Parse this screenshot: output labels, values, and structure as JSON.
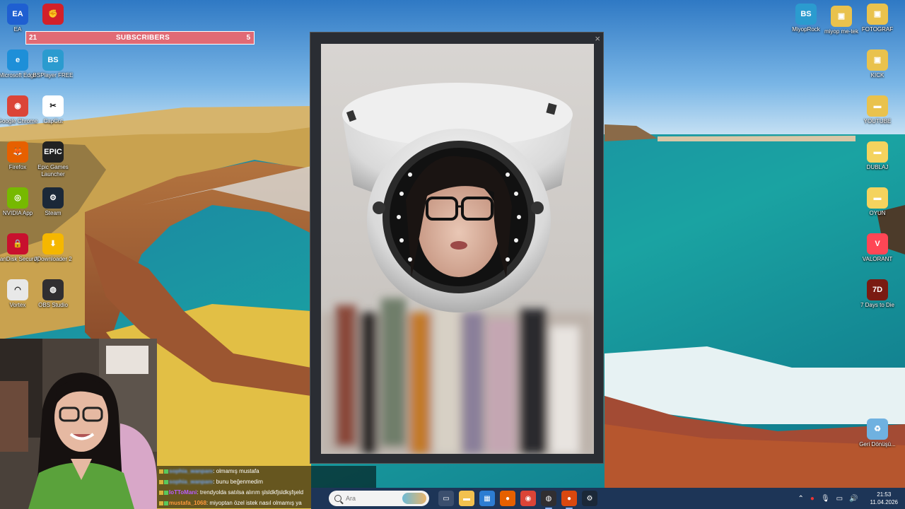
{
  "desktop_icons_left": [
    {
      "label": "EA",
      "icon": "ea-icon",
      "color": "#1f5fd1",
      "glyph": "EA"
    },
    {
      "label": "",
      "icon": "riot-client-icon",
      "color": "#d3202a",
      "glyph": "✊"
    },
    {
      "label": "Microsoft Edge",
      "icon": "edge-icon",
      "color": "#1e8fd8",
      "glyph": "e"
    },
    {
      "label": "BSPlayer FREE",
      "icon": "bsplayer-icon",
      "color": "#2b9bcf",
      "glyph": "BS"
    },
    {
      "label": "Google Chrome",
      "icon": "chrome-icon",
      "color": "#db4437",
      "glyph": "◉"
    },
    {
      "label": "CapCut",
      "icon": "capcut-icon",
      "color": "#ffffff",
      "glyph": "✂"
    },
    {
      "label": "Firefox",
      "icon": "firefox-icon",
      "color": "#e66000",
      "glyph": "🦊"
    },
    {
      "label": "Epic Games Launcher",
      "icon": "epic-games-icon",
      "color": "#222222",
      "glyph": "EPIC"
    },
    {
      "label": "NVIDIA App",
      "icon": "nvidia-icon",
      "color": "#76b900",
      "glyph": "◎"
    },
    {
      "label": "Steam",
      "icon": "steam-icon",
      "color": "#1b2838",
      "glyph": "⚙"
    },
    {
      "label": "SanDisk Security",
      "icon": "sandisk-lock-icon",
      "color": "#c8102e",
      "glyph": "🔒"
    },
    {
      "label": "JDownloader 2",
      "icon": "jdownloader-icon",
      "color": "#f5b700",
      "glyph": "⬇"
    },
    {
      "label": "Vortex",
      "icon": "vortex-icon",
      "color": "#e8e8e8",
      "glyph": "◠"
    },
    {
      "label": "OBS Studio",
      "icon": "obs-icon",
      "color": "#302e31",
      "glyph": "◍"
    }
  ],
  "desktop_icons_right": [
    {
      "label": "MiyopRock",
      "icon": "bsplayer-icon",
      "color": "#2b9bcf",
      "glyph": "BS"
    },
    {
      "label": "miyop me-tek",
      "icon": "folder-photo-icon",
      "color": "#e9c24d",
      "glyph": "▣"
    },
    {
      "label": "FOTOGRAF",
      "icon": "folder-photo-icon",
      "color": "#e9c24d",
      "glyph": "▣"
    },
    {
      "label": "KICK",
      "icon": "folder-photo-icon",
      "color": "#e9c24d",
      "glyph": "▣"
    },
    {
      "label": "YOUTUBE",
      "icon": "folder-icon",
      "color": "#e9c24d",
      "glyph": "▬"
    },
    {
      "label": "DUBLAJ",
      "icon": "folder-icon",
      "color": "#f4d35e",
      "glyph": "▬"
    },
    {
      "label": "OYUN",
      "icon": "folder-icon",
      "color": "#f4d35e",
      "glyph": "▬"
    },
    {
      "label": "VALORANT",
      "icon": "valorant-icon",
      "color": "#ff4655",
      "glyph": "V"
    },
    {
      "label": "7 Days to Die",
      "icon": "7days-icon",
      "color": "#7a1b12",
      "glyph": "7D"
    },
    {
      "label": "Geri Dönüşü...",
      "icon": "recycle-bin-icon",
      "color": "#6fb1e0",
      "glyph": "♻"
    }
  ],
  "subscribers_bar": {
    "left": "21",
    "title": "SUBSCRIBERS",
    "right": "5"
  },
  "photo_window": {
    "close_label": "×"
  },
  "chat": [
    {
      "user": "sophia_wanpanı",
      "message": ": olmamış mustafa",
      "user_color": "#6fa8ff",
      "blurred": true
    },
    {
      "user": "sophia_wanpanı",
      "message": ": bunu beğenmedim",
      "user_color": "#6fa8ff",
      "blurred": true
    },
    {
      "user": "IoTToMani",
      "message": ": trendyolda satılsa alırım şlsldkfjsldkşfşeld",
      "user_color": "#b85cff",
      "blurred": false
    },
    {
      "user": "mustafa_1068",
      "message": ": miyoptan özel istek nasıl olmamış ya",
      "user_color": "#ff9a3c",
      "blurred": false
    }
  ],
  "taskbar": {
    "search_placeholder": "Ara",
    "apps": [
      {
        "name": "task-view-icon",
        "glyph": "▭",
        "color": "#3b4f6e",
        "active": false
      },
      {
        "name": "file-explorer-icon",
        "glyph": "▬",
        "color": "#f2c14e",
        "active": false
      },
      {
        "name": "calculator-icon",
        "glyph": "▦",
        "color": "#2d7dd2",
        "active": false
      },
      {
        "name": "firefox-icon",
        "glyph": "●",
        "color": "#e66000",
        "active": false
      },
      {
        "name": "chrome-icon",
        "glyph": "◉",
        "color": "#db4437",
        "active": false
      },
      {
        "name": "obs-icon",
        "glyph": "◍",
        "color": "#302e31",
        "active": true
      },
      {
        "name": "firefox-dev-icon",
        "glyph": "●",
        "color": "#d9480f",
        "active": true
      },
      {
        "name": "steam-icon",
        "glyph": "⚙",
        "color": "#1b2838",
        "active": false
      }
    ],
    "time": "21:53",
    "date": "11.04.2026"
  }
}
